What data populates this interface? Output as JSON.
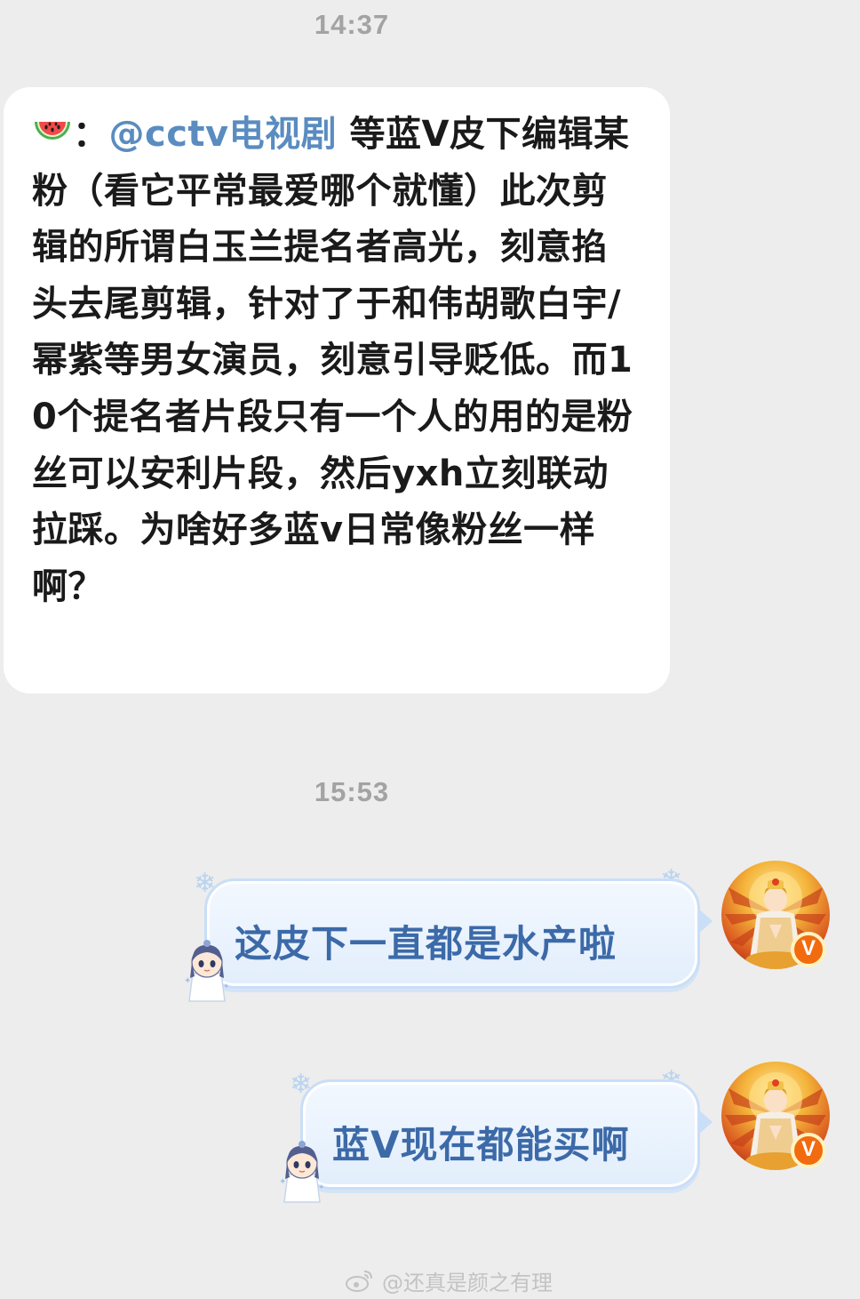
{
  "chat": {
    "timestamp_1": "14:37",
    "timestamp_2": "15:53",
    "incoming": {
      "emoji_icon": "watermelon-icon",
      "prefix": "：",
      "mention": "@cctv电视剧",
      "text": " 等蓝V皮下编辑某粉（看它平常最爱哪个就懂）此次剪辑的所谓白玉兰提名者高光，刻意掐头去尾剪辑，针对了于和伟胡歌白宇/幂紫等男女演员，刻意引导贬低。而10个提名者片段只有一个人的用的是粉丝可以安利片段，然后yxh立刻联动拉踩。为啥好多蓝v日常像粉丝一样啊？"
    },
    "outgoing": [
      {
        "text": "这皮下一直都是水产啦",
        "avatar_badge": "V"
      },
      {
        "text": "蓝V现在都能买啊",
        "avatar_badge": "V"
      }
    ]
  },
  "watermark": {
    "icon": "weibo-icon",
    "text": "@还真是颜之有理"
  },
  "colors": {
    "background": "#ededed",
    "incoming_bubble": "#ffffff",
    "mention": "#5a8cc0",
    "outgoing_text": "#3c6aa8",
    "badge": "#f26b0f"
  }
}
